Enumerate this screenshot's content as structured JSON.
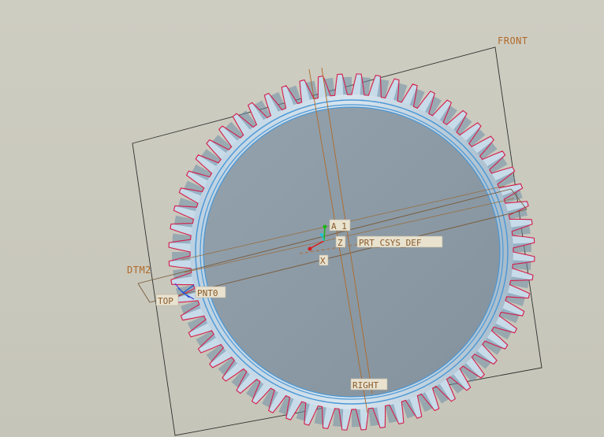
{
  "viewport": {
    "labels": {
      "front": "FRONT",
      "right": "RIGHT",
      "top": "TOP",
      "dtm2": "DTM2",
      "pnt0": "PNT0",
      "axis": "A_1",
      "csys": "PRT_CSYS_DEF",
      "z": "Z",
      "x": "X"
    },
    "colors": {
      "background": "#c9c8bc",
      "gear_face": "#8d9ba5",
      "gear_edge": "#4a97d6",
      "tooth_profile": "#d61c4a",
      "datum": "#b06a2a",
      "frame": "#2f2f2f"
    },
    "model": {
      "type": "spur-gear",
      "teeth_visible": 60
    }
  }
}
